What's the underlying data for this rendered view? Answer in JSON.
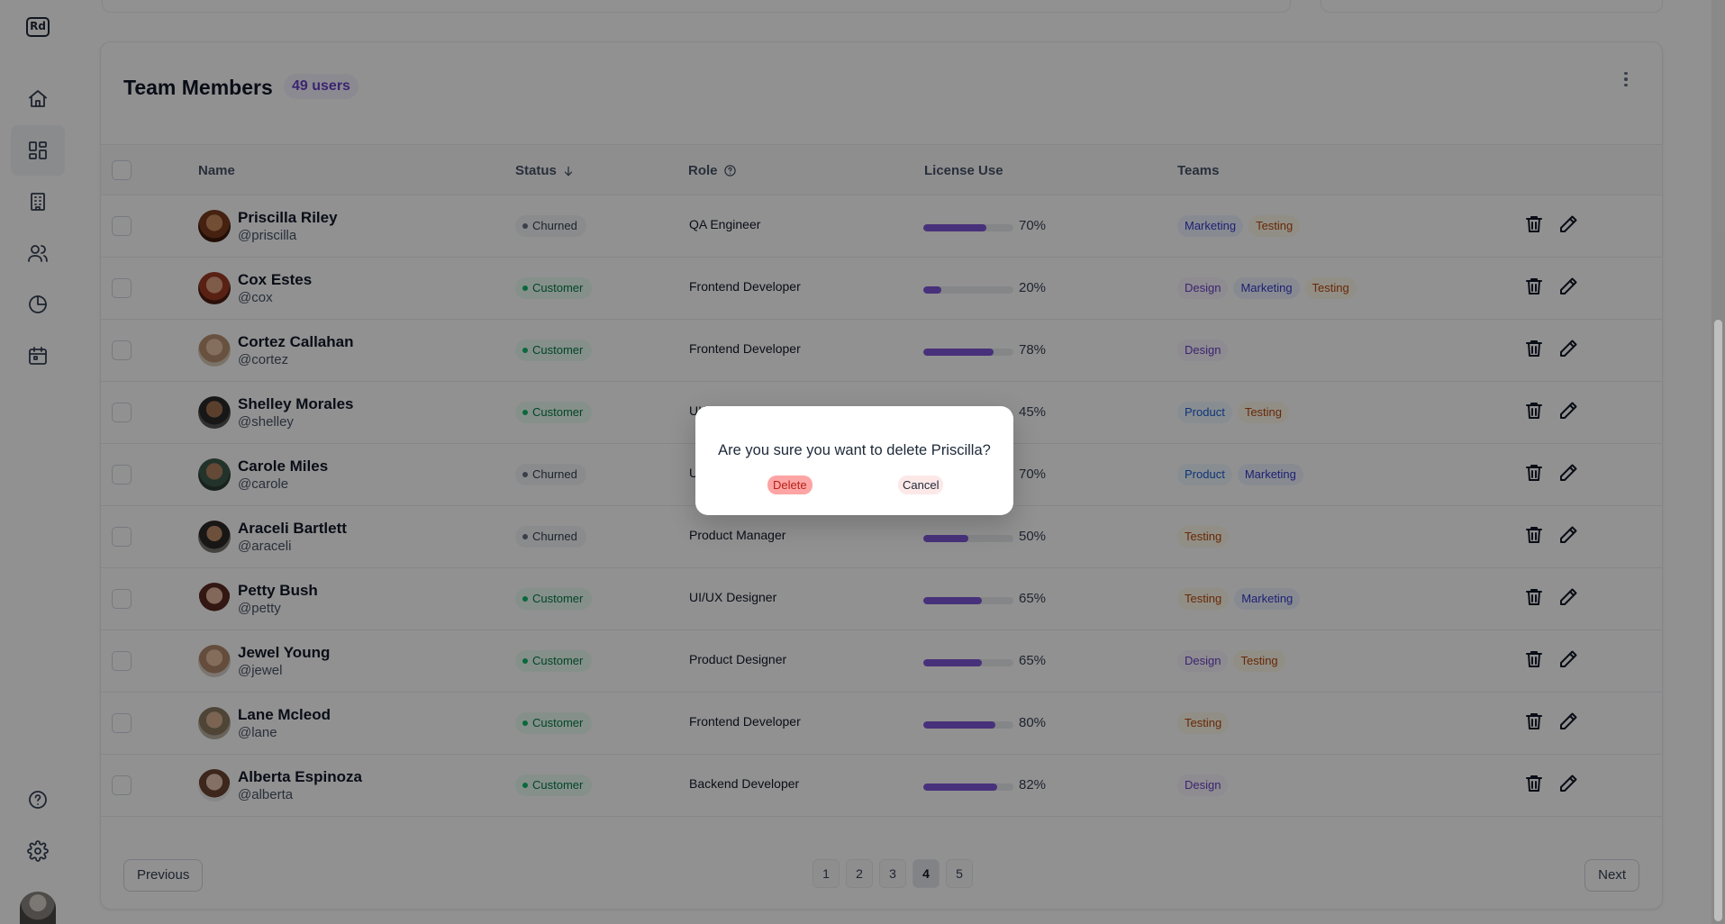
{
  "app": {
    "logo_text": "Rd"
  },
  "sidebar": {
    "items": [
      {
        "name": "home",
        "icon": "home-icon"
      },
      {
        "name": "dashboard",
        "icon": "dashboard-icon",
        "active": true
      },
      {
        "name": "buildings",
        "icon": "building-icon"
      },
      {
        "name": "users",
        "icon": "users-icon"
      },
      {
        "name": "reports",
        "icon": "pie-chart-icon"
      },
      {
        "name": "calendar",
        "icon": "calendar-icon"
      }
    ],
    "bottom": [
      {
        "name": "help",
        "icon": "help-icon"
      },
      {
        "name": "settings",
        "icon": "gear-icon"
      }
    ]
  },
  "table": {
    "title": "Team Members",
    "count_badge": "49 users",
    "columns": {
      "name": "Name",
      "status": "Status",
      "role": "Role",
      "license": "License Use",
      "teams": "Teams"
    },
    "rows": [
      {
        "name": "Priscilla Riley",
        "handle": "@priscilla",
        "status": "Churned",
        "role": "QA Engineer",
        "license": "70%",
        "teams": [
          "Marketing",
          "Testing"
        ]
      },
      {
        "name": "Cox Estes",
        "handle": "@cox",
        "status": "Customer",
        "role": "Frontend Developer",
        "license": "20%",
        "teams": [
          "Design",
          "Marketing",
          "Testing"
        ]
      },
      {
        "name": "Cortez Callahan",
        "handle": "@cortez",
        "status": "Customer",
        "role": "Frontend Developer",
        "license": "78%",
        "teams": [
          "Design"
        ]
      },
      {
        "name": "Shelley Morales",
        "handle": "@shelley",
        "status": "Customer",
        "role": "UI/UX Designer",
        "license": "45%",
        "teams": [
          "Product",
          "Testing"
        ]
      },
      {
        "name": "Carole Miles",
        "handle": "@carole",
        "status": "Churned",
        "role": "UI/UX Designer",
        "license": "70%",
        "teams": [
          "Product",
          "Marketing"
        ]
      },
      {
        "name": "Araceli Bartlett",
        "handle": "@araceli",
        "status": "Churned",
        "role": "Product Manager",
        "license": "50%",
        "teams": [
          "Testing"
        ]
      },
      {
        "name": "Petty Bush",
        "handle": "@petty",
        "status": "Customer",
        "role": "UI/UX Designer",
        "license": "65%",
        "teams": [
          "Testing",
          "Marketing"
        ]
      },
      {
        "name": "Jewel Young",
        "handle": "@jewel",
        "status": "Customer",
        "role": "Product Designer",
        "license": "65%",
        "teams": [
          "Design",
          "Testing"
        ]
      },
      {
        "name": "Lane Mcleod",
        "handle": "@lane",
        "status": "Customer",
        "role": "Frontend Developer",
        "license": "80%",
        "teams": [
          "Testing"
        ]
      },
      {
        "name": "Alberta Espinoza",
        "handle": "@alberta",
        "status": "Customer",
        "role": "Backend Developer",
        "license": "82%",
        "teams": [
          "Design"
        ]
      }
    ]
  },
  "pagination": {
    "previous": "Previous",
    "next": "Next",
    "pages": [
      "1",
      "2",
      "3",
      "4",
      "5"
    ],
    "current": "4"
  },
  "dialog": {
    "message": "Are you sure you want to delete Priscilla?",
    "confirm": "Delete",
    "cancel": "Cancel"
  },
  "colors": {
    "accent": "#7f56d9",
    "overlay": "rgba(0,0,0,0.43)",
    "delete_button": "#fda4a4"
  }
}
